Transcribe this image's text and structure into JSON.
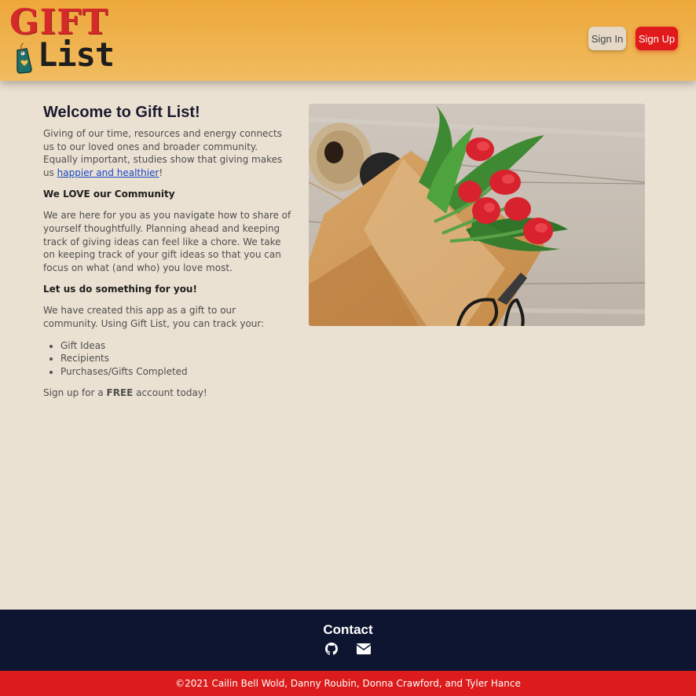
{
  "header": {
    "logo_gift": "GIFT",
    "logo_list": "List",
    "signin_label": "Sign In",
    "signup_label": "Sign Up"
  },
  "main": {
    "title": "Welcome to Gift List!",
    "intro_before": "Giving of our time, resources and energy connects us to our loved ones and broader community. Equally important, studies show that giving makes us ",
    "intro_link": "happier and healthier",
    "intro_after": "!",
    "community_heading": "We LOVE our Community",
    "community_text": "We are here for you as you navigate how to share of yourself thoughtfully. Planning ahead and keeping track of giving ideas can feel like a chore. We take on keeping track of your gift ideas so that you can focus on what (and who) you love most.",
    "do_heading": "Let us do something for you!",
    "do_text": "We have created this app as a gift to our community. Using Gift List, you can track your:",
    "track_items": [
      "Gift Ideas",
      "Recipients",
      "Purchases/Gifts Completed"
    ],
    "signup_before": "Sign up for a ",
    "signup_bold": "FREE",
    "signup_after": " account today!"
  },
  "footer": {
    "contact_title": "Contact",
    "icons": [
      "github-icon",
      "envelope-icon"
    ],
    "copyright": "©2021 Cailin Bell Wold, Danny Roubin, Donna Crawford, and Tyler Hance"
  },
  "colors": {
    "header_bg": "#eda83a",
    "page_bg": "#ebe1d2",
    "accent_red": "#e01a1a",
    "footer_bg": "#0e1530",
    "link": "#1646c8"
  }
}
